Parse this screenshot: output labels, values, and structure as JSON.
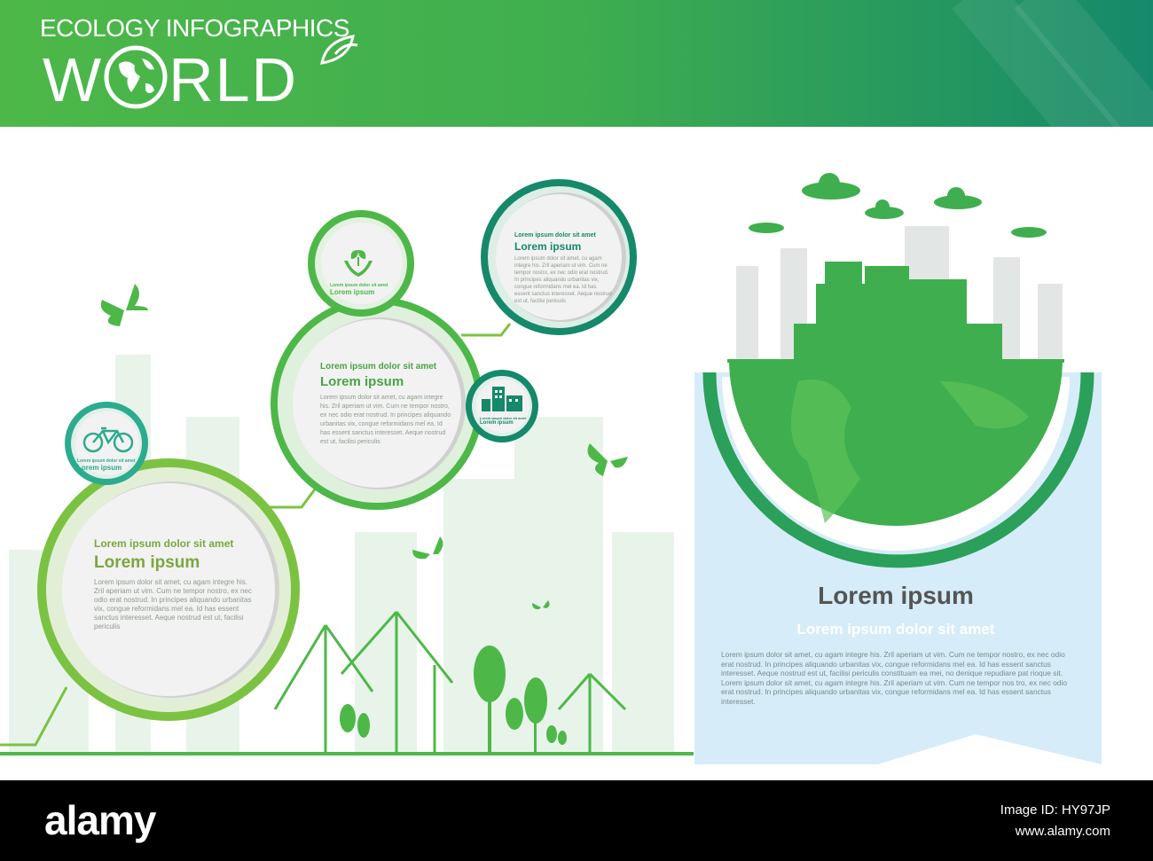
{
  "header": {
    "subtitle": "ECOLOGY INFOGRAPHICS",
    "title_pre": "W",
    "title_post": "RLD"
  },
  "circles": [
    {
      "sub": "Lorem ipsum dolor sit amet",
      "title": "Lorem ipsum",
      "body": "Lorem ipsum dolor sit amet, cu agam integre his. Zril aperiam ut vim. Cum ne tempor nostro, ex nec odio erat nostrud. In principes aliquando urbanitas vix, congue reformidans mel ea. Id has essent sanctus interesset. Aeque nostrud est ut, facilisi periculis"
    },
    {
      "sub": "Lorem ipsum dolor sit amet",
      "title": "Lorem ipsum",
      "body": "Lorem ipsum dolor sit amet, cu agam integre his. Zril aperiam ut vim. Cum ne tempor nostro, ex nec odio erat nostrud. In principes aliquando urbanitas vix, congue reformidans mel ea. Id has essent sanctus interesset. Aeque nostrud est ut, facilisi periculis"
    },
    {
      "sub": "Lorem ipsum dolor sit amet",
      "title": "Lorem ipsum",
      "body": "Lorem ipsum dolor sit amet, cu agam integre his. Zril aperiam ut vim. Cum ne tempor nostro, ex nec odio erat nostrud. In principes aliquando urbanitas vix, congue reformidans mel ea. Id has essent sanctus interesset. Aeque nostrud est ut, facilisi periculis"
    }
  ],
  "small_circles": [
    {
      "icon": "bicycle-icon",
      "sub": "Lorem ipsum dolor sit amet",
      "title": "Lorem ipsum"
    },
    {
      "icon": "plant-in-hands-icon",
      "sub": "Lorem ipsum dolor sit amet",
      "title": "Lorem ipsum"
    },
    {
      "icon": "buildings-icon",
      "sub": "Lorem ipsum dolor sit amet",
      "title": "Lorem ipsum"
    }
  ],
  "panel": {
    "title": "Lorem ipsum",
    "subtitle": "Lorem ipsum dolor sit amet",
    "body": "Lorem ipsum dolor sit amet, cu agam integre his. Zril aperiam ut vim. Cum ne tempor nostro, ex nec odio erat nostrud. In principes aliquando urbanitas vix, congue reformidans mel ea. Id has essent sanctus interesset. Aeque nostrud est ut, facilisi periculis constituam ea mei, no denique repudiare pat rioque sit. Lorem ipsum dolor sit amet, cu agam integre his. Zril aperiam ut vim. Cum ne tempor nos tro, ex nec odio erat nostrud. In principes aliquando urbanitas vix, congue reformidans mel ea. Id has essent sanctus interesset."
  },
  "footer": {
    "logo": "alamy",
    "image_id": "Image ID: HY97JP",
    "url": "www.alamy.com"
  },
  "colors": {
    "green": "#4db848",
    "teal": "#15896a",
    "light_green": "#7cc242",
    "panel_blue": "#d6ecf8"
  }
}
